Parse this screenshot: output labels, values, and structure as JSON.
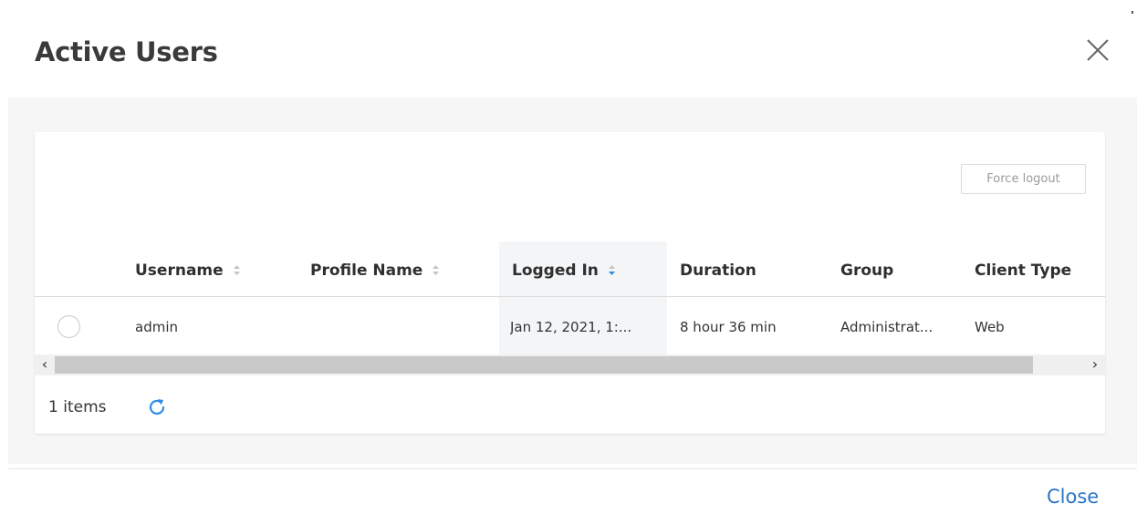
{
  "dialog": {
    "title": "Active Users",
    "close_icon": "close-x-icon",
    "close_label": "Close"
  },
  "toolbar": {
    "force_logout_label": "Force logout"
  },
  "table": {
    "columns": [
      {
        "label": "Username",
        "sortable": true,
        "sort": "none"
      },
      {
        "label": "Profile Name",
        "sortable": true,
        "sort": "none"
      },
      {
        "label": "Logged In",
        "sortable": true,
        "sort": "descending"
      },
      {
        "label": "Duration",
        "sortable": false
      },
      {
        "label": "Group",
        "sortable": false
      },
      {
        "label": "Client Type",
        "sortable": false
      }
    ],
    "rows": [
      {
        "selected": false,
        "username": "admin",
        "profile_name": "",
        "logged_in": "Jan 12, 2021, 1:...",
        "duration": "8 hour 36 min",
        "group": "Administrat...",
        "client_type": "Web"
      }
    ]
  },
  "footer": {
    "item_count": "1 items",
    "refresh_icon": "refresh-icon"
  },
  "colors": {
    "accent": "#2b76c8",
    "sort_active": "#2e8be6",
    "panel_bg": "#f6f6f6"
  }
}
